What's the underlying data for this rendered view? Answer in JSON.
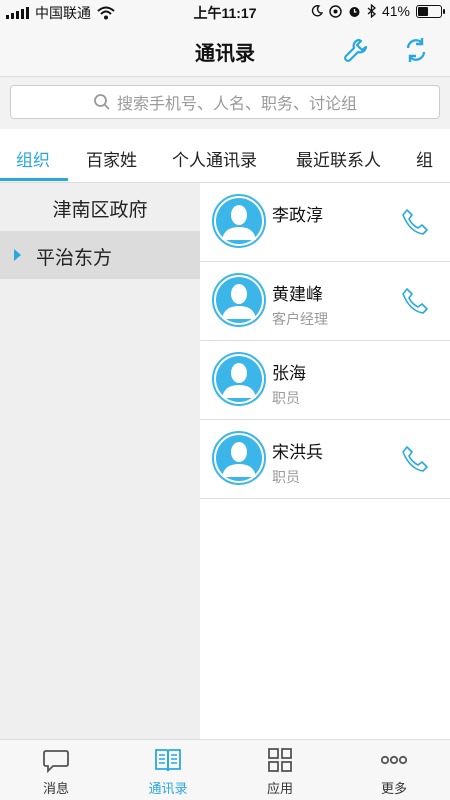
{
  "status": {
    "carrier": "中国联通",
    "time": "上午11:17",
    "battery": "41%"
  },
  "header": {
    "title": "通讯录"
  },
  "search": {
    "placeholder": "搜索手机号、人名、职务、讨论组"
  },
  "tabs": [
    {
      "label": "组织",
      "active": true
    },
    {
      "label": "百家姓"
    },
    {
      "label": "个人通讯录"
    },
    {
      "label": "最近联系人"
    },
    {
      "label": "组"
    }
  ],
  "org": {
    "items": [
      {
        "label": "津南区政府"
      },
      {
        "label": "平治东方",
        "selected": true
      }
    ]
  },
  "contacts": [
    {
      "name": "李政淳",
      "role": "",
      "phone": true
    },
    {
      "name": "黄建峰",
      "role": "客户经理",
      "phone": true
    },
    {
      "name": "张海",
      "role": "职员",
      "phone": false
    },
    {
      "name": "宋洪兵",
      "role": "职员",
      "phone": true
    }
  ],
  "bottom_nav": [
    {
      "label": "消息",
      "icon": "chat-icon"
    },
    {
      "label": "通讯录",
      "icon": "book-icon",
      "active": true
    },
    {
      "label": "应用",
      "icon": "grid-icon"
    },
    {
      "label": "更多",
      "icon": "more-icon"
    }
  ],
  "colors": {
    "accent": "#29a8e0",
    "avatar": "#3cb6e8"
  }
}
